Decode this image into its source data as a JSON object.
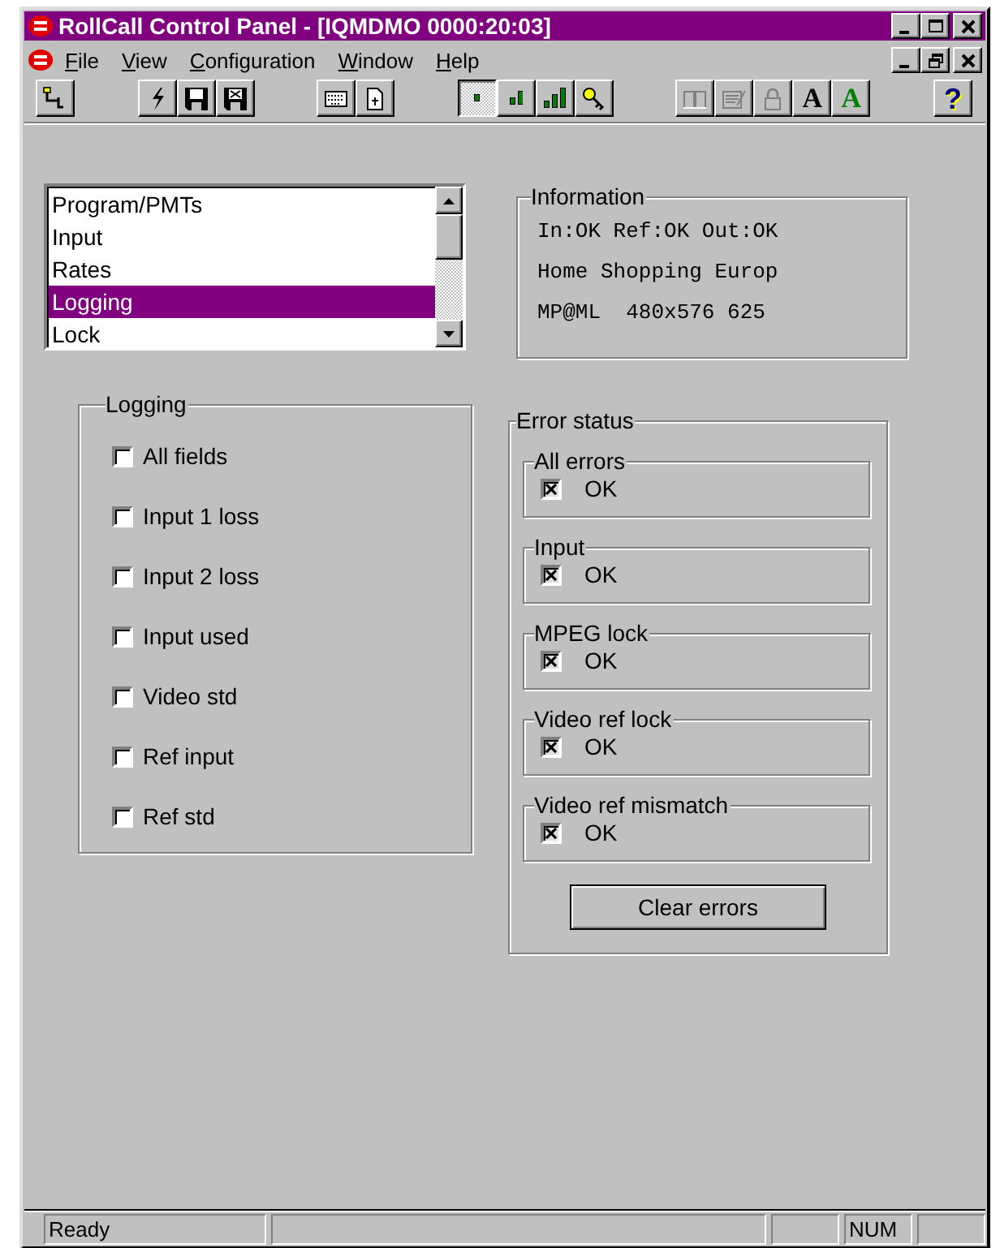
{
  "window": {
    "title": "RollCall Control Panel - [IQMDMO 0000:20:03]"
  },
  "menu": [
    {
      "label": "File",
      "mnemonic": true
    },
    {
      "label": "View",
      "mnemonic": true
    },
    {
      "label": "Configuration",
      "mnemonic": true
    },
    {
      "label": "Window",
      "mnemonic": true
    },
    {
      "label": "Help",
      "mnemonic": true
    }
  ],
  "toolbar": {
    "groups": [
      {
        "buttons": [
          {
            "kind": "plug",
            "pressed": false,
            "disabled": false
          }
        ]
      },
      {
        "buttons": [
          {
            "kind": "lightning",
            "pressed": false,
            "disabled": false
          },
          {
            "kind": "save",
            "pressed": false,
            "disabled": false
          },
          {
            "kind": "save-all",
            "pressed": false,
            "disabled": false
          }
        ]
      },
      {
        "buttons": [
          {
            "kind": "keypad",
            "pressed": false,
            "disabled": false
          },
          {
            "kind": "page",
            "pressed": false,
            "disabled": false
          }
        ]
      },
      {
        "buttons": [
          {
            "kind": "bars-1",
            "pressed": true,
            "disabled": false
          },
          {
            "kind": "bars-2",
            "pressed": false,
            "disabled": false
          },
          {
            "kind": "bars-3",
            "pressed": false,
            "disabled": false
          },
          {
            "kind": "key",
            "pressed": false,
            "disabled": false
          }
        ]
      },
      {
        "buttons": [
          {
            "kind": "book",
            "pressed": false,
            "disabled": true
          },
          {
            "kind": "form",
            "pressed": false,
            "disabled": true
          },
          {
            "kind": "lock",
            "pressed": false,
            "disabled": true
          },
          {
            "kind": "letter",
            "glyph": "A",
            "color": "#000000",
            "pressed": false,
            "disabled": false
          },
          {
            "kind": "letter",
            "glyph": "A",
            "color": "#008000",
            "pressed": false,
            "disabled": false
          }
        ]
      },
      {
        "buttons": [
          {
            "kind": "help",
            "glyph": "?",
            "pressed": false,
            "disabled": false
          }
        ]
      }
    ]
  },
  "list": {
    "items": [
      {
        "label": "Program/PMTs",
        "selected": false
      },
      {
        "label": "Input",
        "selected": false
      },
      {
        "label": "Rates",
        "selected": false
      },
      {
        "label": "Logging",
        "selected": true
      },
      {
        "label": "Lock",
        "selected": false
      }
    ]
  },
  "information": {
    "title": "Information",
    "lines": [
      "In:OK Ref:OK Out:OK",
      "Home Shopping Europ",
      "MP@ML  480x576 625"
    ]
  },
  "logging": {
    "title": "Logging",
    "options": [
      {
        "label": "All fields",
        "checked": false
      },
      {
        "label": "Input 1 loss",
        "checked": false
      },
      {
        "label": "Input 2 loss",
        "checked": false
      },
      {
        "label": "Input used",
        "checked": false
      },
      {
        "label": "Video std",
        "checked": false
      },
      {
        "label": "Ref input",
        "checked": false
      },
      {
        "label": "Ref std",
        "checked": false
      }
    ]
  },
  "error_status": {
    "title": "Error status",
    "groups": [
      {
        "title": "All errors",
        "checked": true,
        "status": "OK"
      },
      {
        "title": "Input",
        "checked": true,
        "status": "OK"
      },
      {
        "title": "MPEG lock",
        "checked": true,
        "status": "OK"
      },
      {
        "title": "Video ref lock",
        "checked": true,
        "status": "OK"
      },
      {
        "title": "Video ref mismatch",
        "checked": true,
        "status": "OK"
      }
    ],
    "clear_button": "Clear errors"
  },
  "status_bar": {
    "panes": [
      {
        "kind": "message",
        "text": "Ready"
      },
      {
        "kind": "spacer"
      },
      {
        "kind": "indicator"
      },
      {
        "kind": "indicator",
        "text": "NUM"
      },
      {
        "kind": "indicator"
      }
    ]
  }
}
